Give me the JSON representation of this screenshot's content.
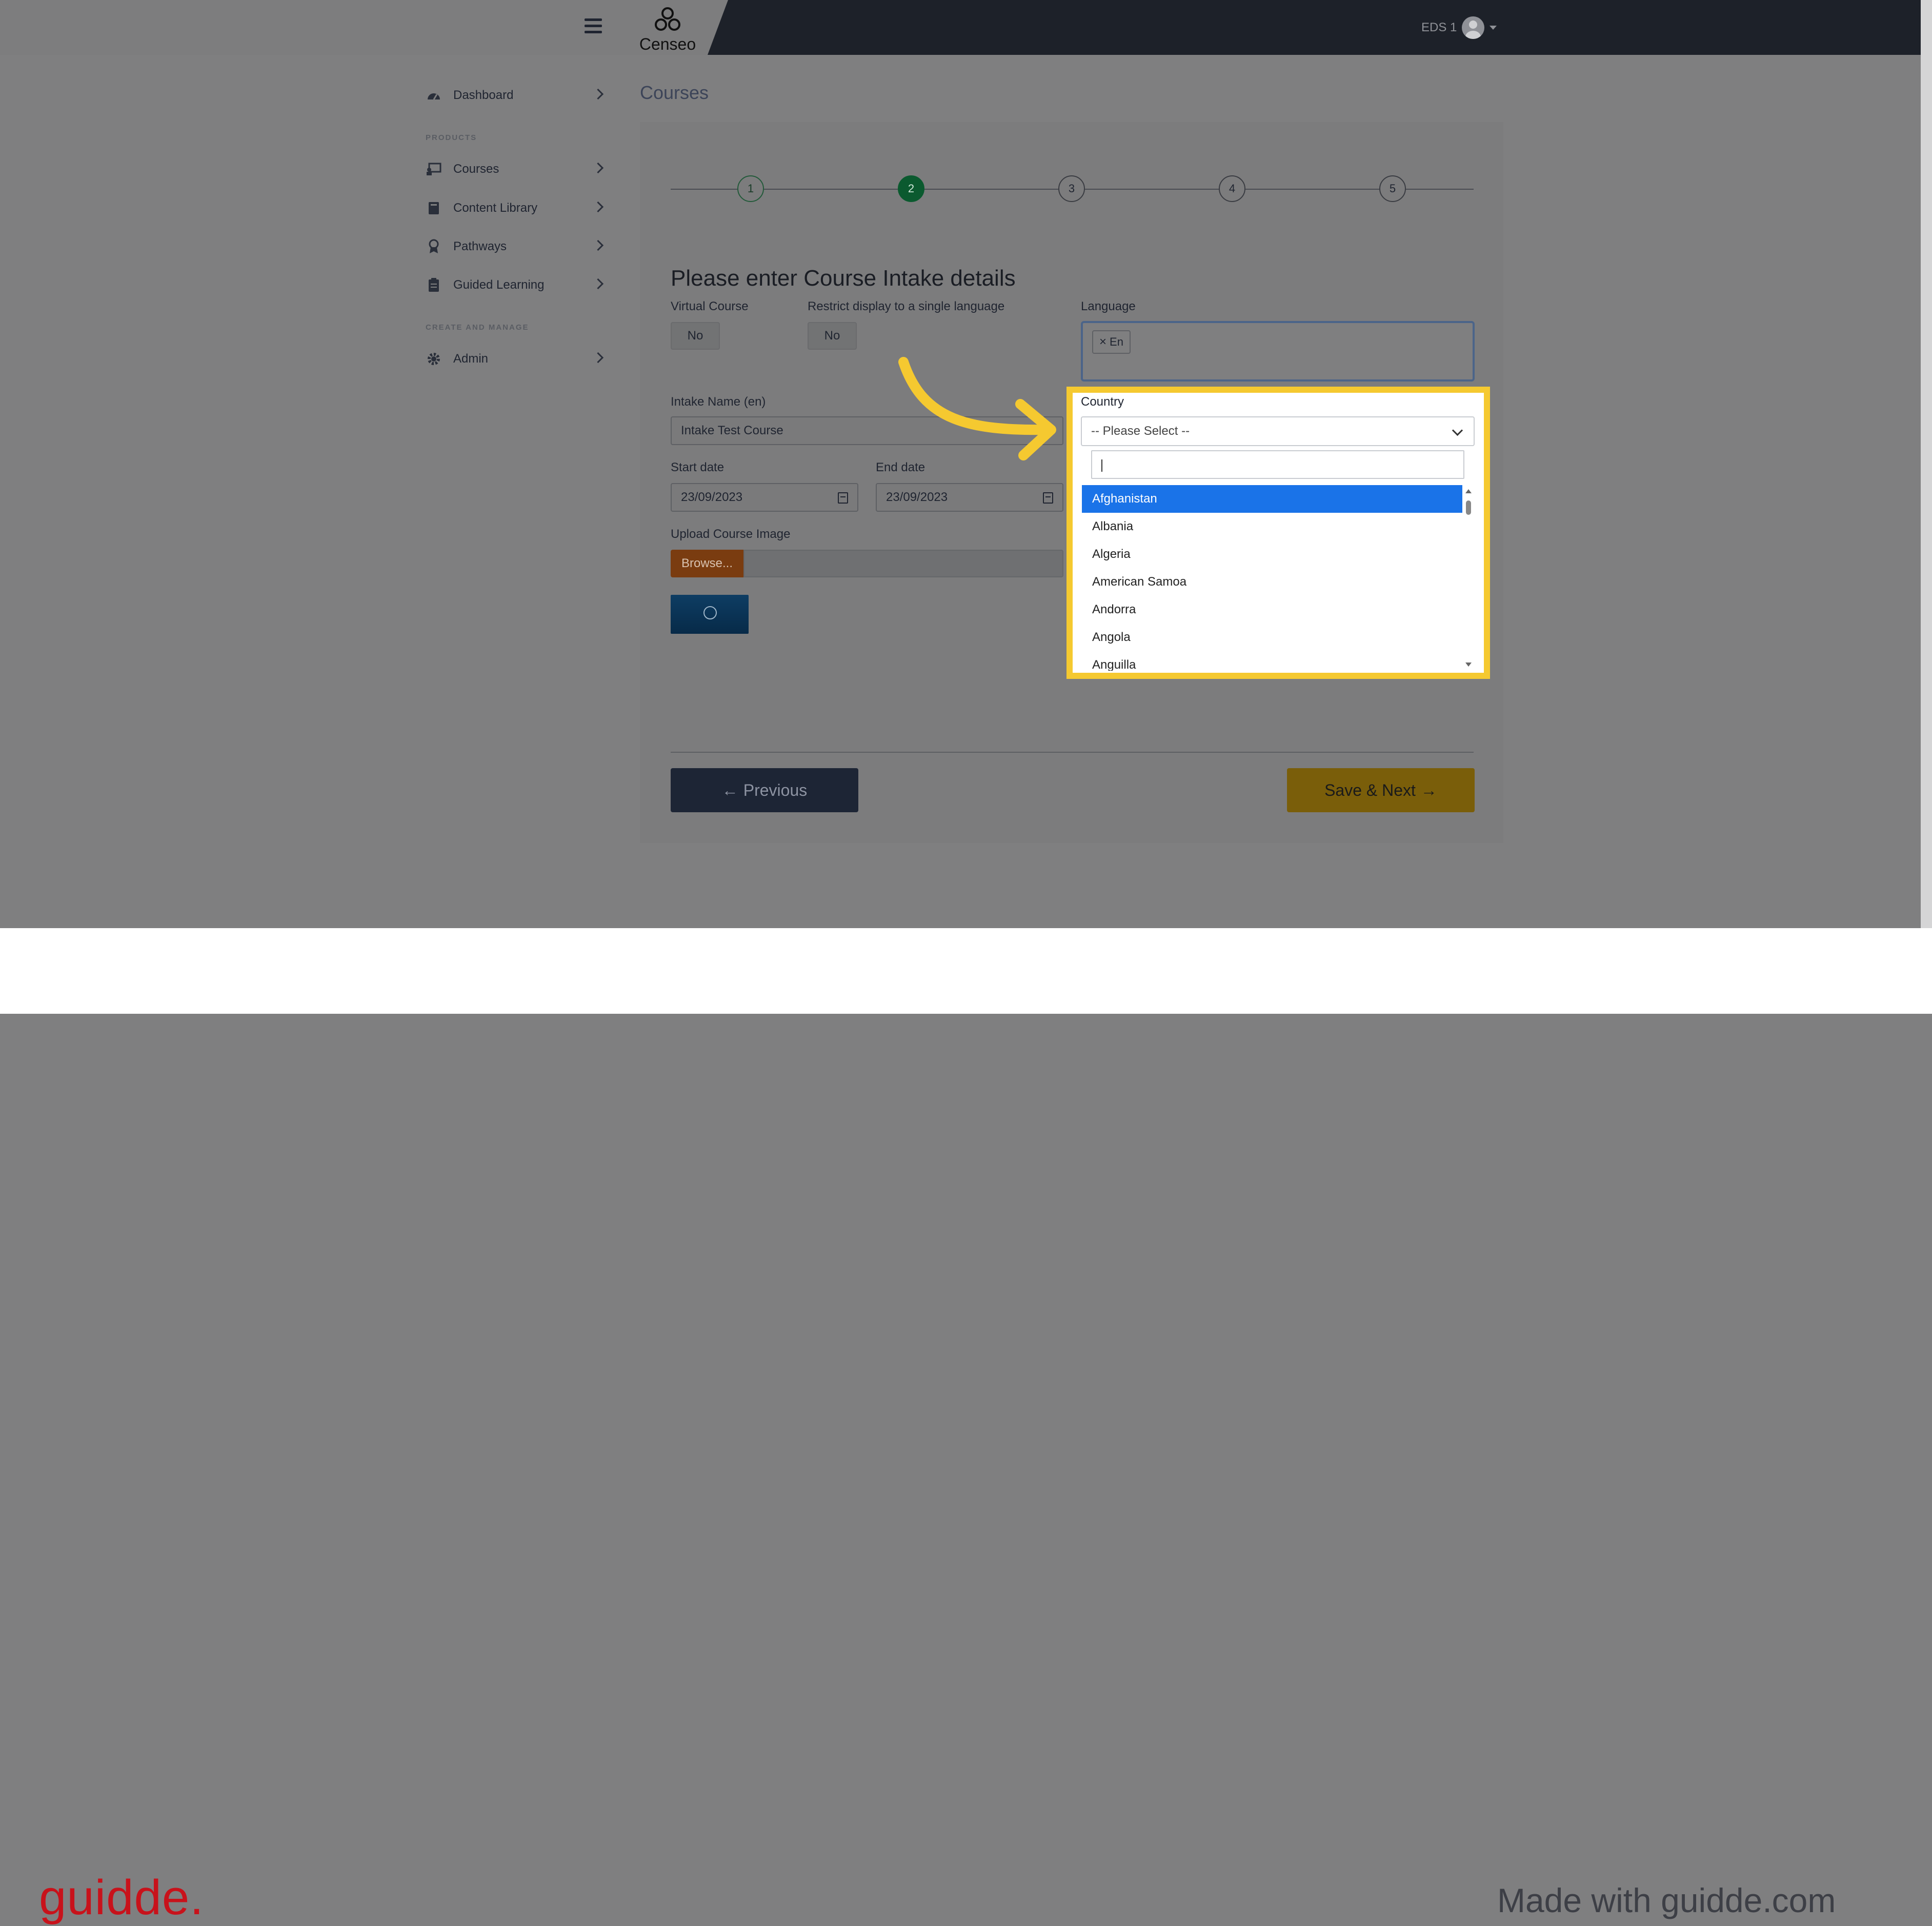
{
  "header": {
    "logo_text": "Censeo",
    "user_label": "EDS 1"
  },
  "sidebar": {
    "items": [
      {
        "label": "Dashboard"
      },
      {
        "label": "Courses"
      },
      {
        "label": "Content Library"
      },
      {
        "label": "Pathways"
      },
      {
        "label": "Guided Learning"
      },
      {
        "label": "Admin"
      }
    ],
    "section_products": "PRODUCTS",
    "section_create": "CREATE AND MANAGE"
  },
  "page": {
    "title": "Courses",
    "steps": [
      "1",
      "2",
      "3",
      "4",
      "5"
    ],
    "active_step": 2,
    "section_title": "Please enter Course Intake details"
  },
  "form": {
    "virtual_course_label": "Virtual Course",
    "virtual_course_value": "No",
    "restrict_label": "Restrict display to a single language",
    "restrict_value": "No",
    "language_label": "Language",
    "language_chip": "En",
    "intake_name_label": "Intake Name (en)",
    "intake_name_value": "Intake Test Course",
    "start_date_label": "Start date",
    "start_date_value": "23/09/2023",
    "end_date_label": "End date",
    "end_date_value": "23/09/2023",
    "upload_label": "Upload Course Image",
    "browse_label": "Browse..."
  },
  "country": {
    "label": "Country",
    "placeholder": "-- Please Select --",
    "options": [
      "Afghanistan",
      "Albania",
      "Algeria",
      "American Samoa",
      "Andorra",
      "Angola",
      "Anguilla"
    ],
    "selected": "Afghanistan"
  },
  "actions": {
    "previous_label": "Previous",
    "next_label": "Save & Next"
  },
  "footer": {
    "brand": "guidde.",
    "made_with": "Made with guidde.com"
  },
  "colors": {
    "highlight": "#f5c930",
    "selected_option": "#1a73e8",
    "brand_red": "#c8121b",
    "active_step": "#0b5a2f"
  }
}
